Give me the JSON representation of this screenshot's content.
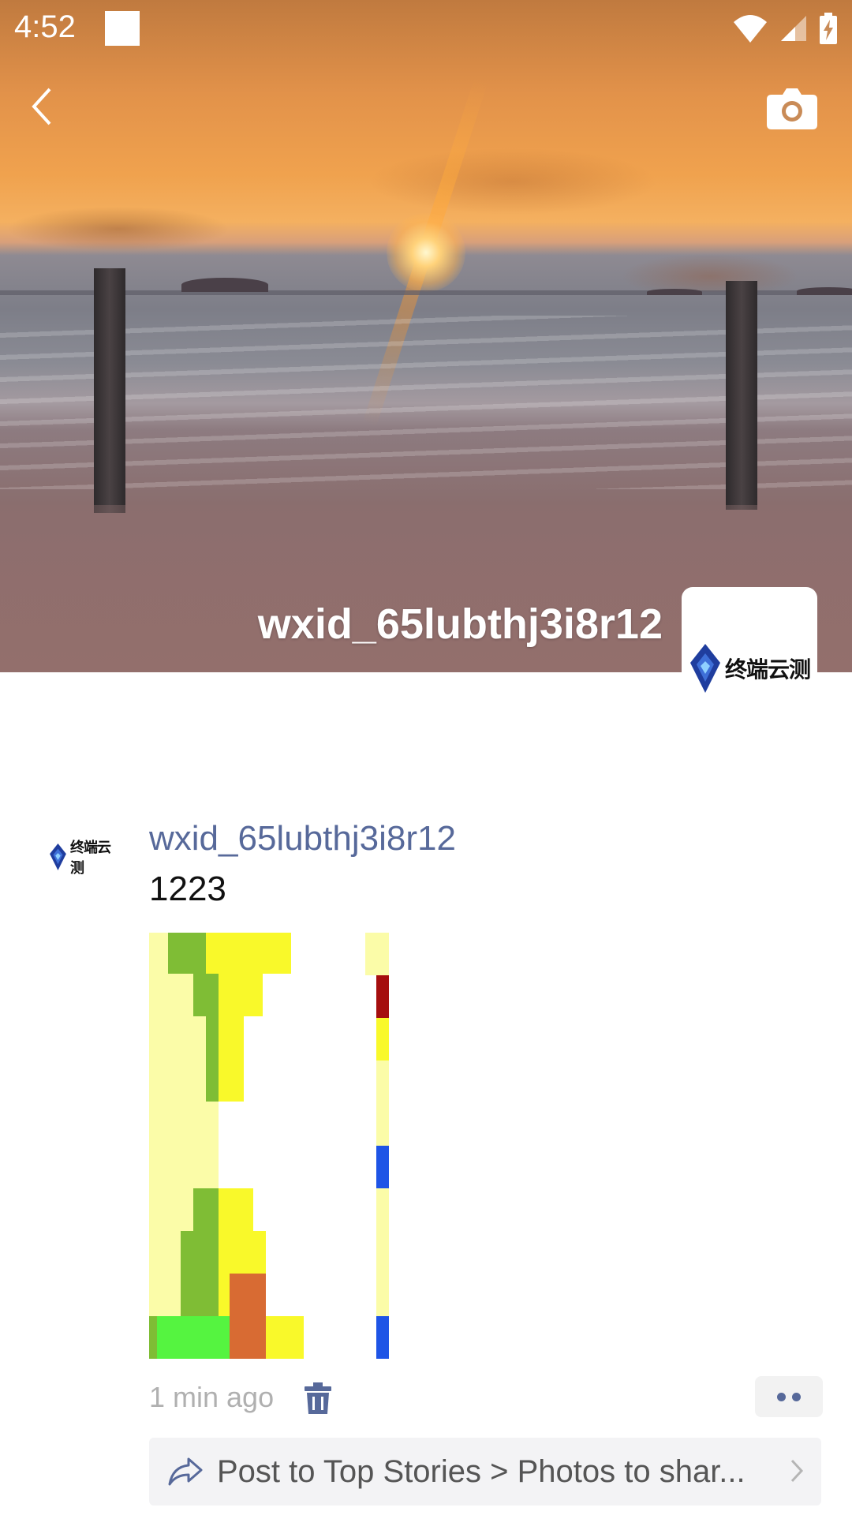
{
  "status_bar": {
    "time": "4:52",
    "icons": [
      "wifi-icon",
      "signal-icon",
      "battery-charging-icon"
    ]
  },
  "header": {
    "back_icon": "back-icon",
    "camera_icon": "camera-icon"
  },
  "profile": {
    "username": "wxid_65lubthj3i8r12",
    "avatar_logo_text": "终端云测"
  },
  "post": {
    "author": "wxid_65lubthj3i8r12",
    "text": "1223",
    "avatar_logo_text": "终端云测",
    "time": "1 min ago",
    "delete_icon": "trash-icon",
    "more_icon": "more-icon"
  },
  "share_bar": {
    "icon": "share-icon",
    "label": "Post to Top Stories > Photos to shar...",
    "chevron_icon": "chevron-right-icon"
  },
  "colors": {
    "link_blue": "#57699a",
    "meta_gray": "#b0b0b0",
    "share_bg": "#f3f3f5"
  }
}
